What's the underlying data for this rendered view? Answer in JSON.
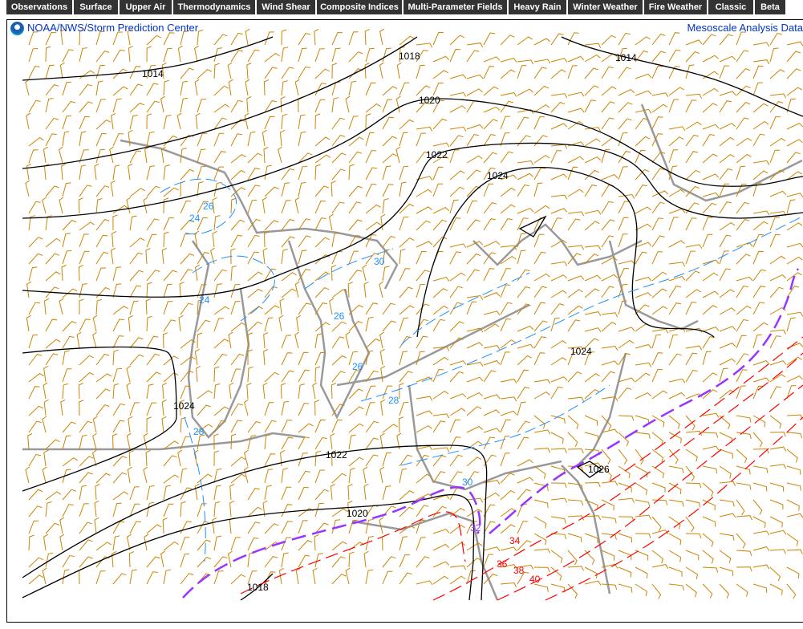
{
  "nav": [
    "Observations",
    "Surface",
    "Upper Air",
    "Thermodynamics",
    "Wind Shear",
    "Composite Indices",
    "Multi-Parameter Fields",
    "Heavy Rain",
    "Winter Weather",
    "Fire Weather",
    "Classic",
    "Beta"
  ],
  "header": {
    "title": "NOAA/NWS/Storm Prediction Center",
    "right_title": "Mesoscale Analysis Data"
  },
  "map": {
    "colors": {
      "isobar": "#000000",
      "wind_barb": "#cc8400",
      "dewpoint_low": "#1e90ff",
      "temp_high": "#ff0000",
      "threshold": "#9933ff",
      "border": "#999999"
    },
    "isobar_labels": [
      "1014",
      "1018",
      "1014",
      "1020",
      "1022",
      "1024",
      "1024",
      "1024",
      "1022",
      "1020",
      "1018",
      "1026"
    ],
    "blue_labels": [
      "26",
      "24",
      "24",
      "26",
      "26",
      "28",
      "28",
      "30",
      "30"
    ],
    "purple_labels": [
      "32"
    ],
    "red_labels": [
      "34",
      "36",
      "38",
      "40"
    ]
  }
}
